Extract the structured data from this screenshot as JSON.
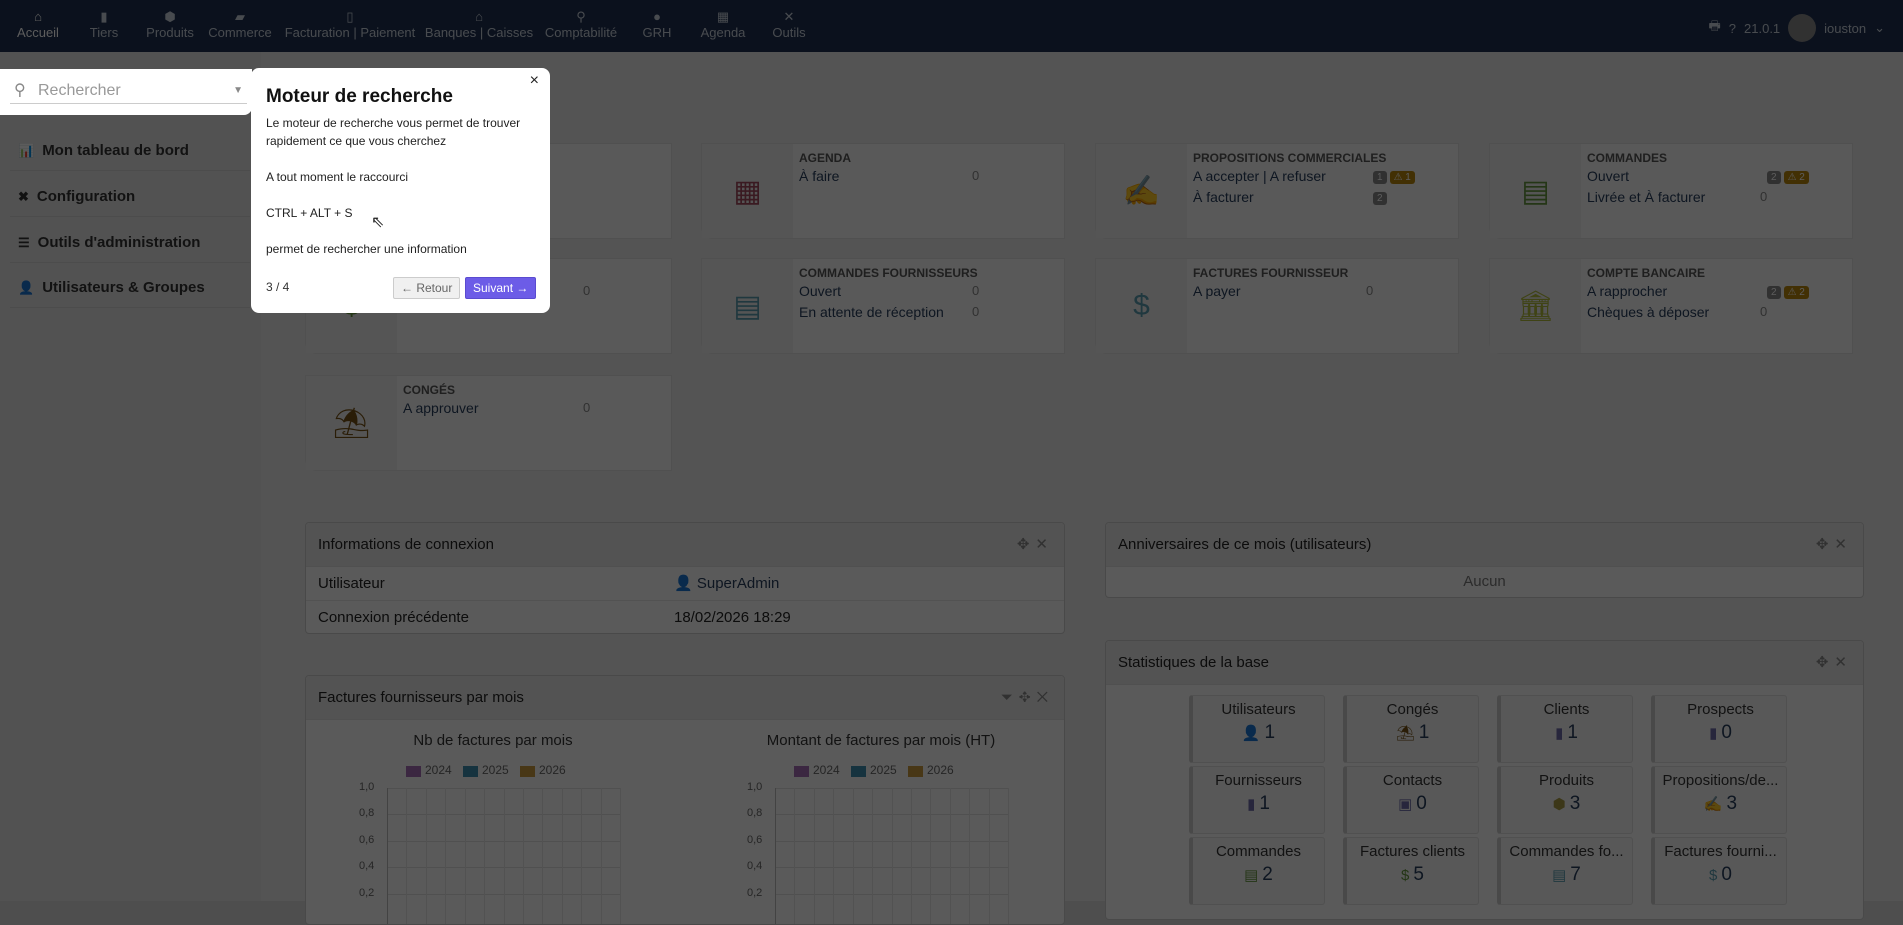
{
  "nav": {
    "items": [
      {
        "label": "Accueil",
        "icon": "home-icon",
        "glyph": "⌂"
      },
      {
        "label": "Tiers",
        "icon": "building-icon",
        "glyph": "▮"
      },
      {
        "label": "Produits",
        "icon": "cube-icon",
        "glyph": "⬢"
      },
      {
        "label": "Commerce",
        "icon": "briefcase-icon",
        "glyph": "▰"
      },
      {
        "label": "Facturation | Paiement",
        "icon": "invoice-icon",
        "glyph": "▯"
      },
      {
        "label": "Banques | Caisses",
        "icon": "bank-icon",
        "glyph": "⌂"
      },
      {
        "label": "Comptabilité",
        "icon": "search-dollar-icon",
        "glyph": "⚲"
      },
      {
        "label": "GRH",
        "icon": "user-tie-icon",
        "glyph": "●"
      },
      {
        "label": "Agenda",
        "icon": "calendar-icon",
        "glyph": "▦"
      },
      {
        "label": "Outils",
        "icon": "tools-icon",
        "glyph": "✕"
      }
    ],
    "version": "21.0.1",
    "user": "iouston"
  },
  "search": {
    "placeholder": "Rechercher"
  },
  "sidebar": {
    "items": [
      {
        "label": "Mon tableau de bord",
        "icon": "chart-icon",
        "glyph": "📊"
      },
      {
        "label": "Configuration",
        "icon": "tools-icon",
        "glyph": "✖"
      },
      {
        "label": "Outils d'administration",
        "icon": "server-icon",
        "glyph": "☰"
      },
      {
        "label": "Utilisateurs & Groupes",
        "icon": "user-icon",
        "glyph": "👤"
      }
    ]
  },
  "boxes": [
    {
      "title": "",
      "lines": [],
      "icon": "hidden-icon",
      "glyph": "",
      "color": "#3d6b2e"
    },
    {
      "title": "Agenda",
      "icon": "calendar-icon",
      "glyph": "▦",
      "color": "#a1485d",
      "lines": [
        {
          "label": "À faire",
          "value": "0"
        }
      ]
    },
    {
      "title": "Propositions commerciales",
      "icon": "proposal-signature-icon",
      "glyph": "✍",
      "color": "#65953d",
      "lines": [
        {
          "label": "A accepter | A refuser",
          "badge": "1",
          "warn": "⚠ 1"
        },
        {
          "label": "À facturer",
          "badge": "2"
        }
      ]
    },
    {
      "title": "Commandes",
      "icon": "order-document-icon",
      "glyph": "▤",
      "color": "#65953d",
      "lines": [
        {
          "label": "Ouvert",
          "badge": "2",
          "warn": "⚠ 2"
        },
        {
          "label": "Livrée et À facturer",
          "value": "0"
        }
      ]
    },
    {
      "title": "",
      "icon": "invoice-icon",
      "glyph": "$",
      "color": "#65953d",
      "lines": [
        {
          "label": "",
          "value": "0"
        }
      ]
    },
    {
      "title": "Commandes fournisseurs",
      "icon": "supplier-order-icon",
      "glyph": "▤",
      "color": "#599caf",
      "lines": [
        {
          "label": "Ouvert",
          "value": "0"
        },
        {
          "label": "En attente de réception",
          "value": "0"
        }
      ]
    },
    {
      "title": "Factures fournisseur",
      "icon": "supplier-invoice-icon",
      "glyph": "$",
      "color": "#599caf",
      "lines": [
        {
          "label": "A payer",
          "value": "0"
        }
      ]
    },
    {
      "title": "Compte bancaire",
      "icon": "bank-icon",
      "glyph": "🏛",
      "color": "#b0bb39",
      "lines": [
        {
          "label": "A rapprocher",
          "badge": "2",
          "warn": "⚠ 2"
        },
        {
          "label": "Chèques à déposer",
          "value": "0"
        }
      ]
    },
    {
      "title": "Congés",
      "icon": "beach-umbrella-icon",
      "glyph": "⛱",
      "color": "#755114",
      "lines": [
        {
          "label": "A approuver",
          "value": "0"
        }
      ]
    }
  ],
  "login_info": {
    "title": "Informations de connexion",
    "rows": [
      {
        "label": "Utilisateur",
        "value": "SuperAdmin"
      },
      {
        "label": "Connexion précédente",
        "value": "18/02/2026 18:29"
      }
    ]
  },
  "birthdays": {
    "title": "Anniversaires de ce mois (utilisateurs)",
    "empty": "Aucun"
  },
  "stats": {
    "title": "Statistiques de la base",
    "tiles": [
      {
        "label": "Utilisateurs",
        "value": "1",
        "icon": "user-icon",
        "glyph": "👤",
        "color": "#755114"
      },
      {
        "label": "Congés",
        "value": "1",
        "icon": "beach-umbrella-icon",
        "glyph": "⛱",
        "color": "#755114"
      },
      {
        "label": "Clients",
        "value": "1",
        "icon": "building-icon",
        "glyph": "▮",
        "color": "#6c6aa8"
      },
      {
        "label": "Prospects",
        "value": "0",
        "icon": "building-icon",
        "glyph": "▮",
        "color": "#6c6aa8"
      },
      {
        "label": "Fournisseurs",
        "value": "1",
        "icon": "building-icon",
        "glyph": "▮",
        "color": "#6c6aa8"
      },
      {
        "label": "Contacts",
        "value": "0",
        "icon": "contact-card-icon",
        "glyph": "▣",
        "color": "#6c6aa8"
      },
      {
        "label": "Produits",
        "value": "3",
        "icon": "cube-icon",
        "glyph": "⬢",
        "color": "#a69944"
      },
      {
        "label": "Propositions/de...",
        "value": "3",
        "icon": "proposal-signature-icon",
        "glyph": "✍",
        "color": "#65953d"
      },
      {
        "label": "Commandes",
        "value": "2",
        "icon": "order-document-icon",
        "glyph": "▤",
        "color": "#65953d"
      },
      {
        "label": "Factures clients",
        "value": "5",
        "icon": "invoice-icon",
        "glyph": "$",
        "color": "#65953d"
      },
      {
        "label": "Commandes fo...",
        "value": "7",
        "icon": "supplier-order-icon",
        "glyph": "▤",
        "color": "#599caf"
      },
      {
        "label": "Factures fourni...",
        "value": "0",
        "icon": "supplier-invoice-icon",
        "glyph": "$",
        "color": "#599caf"
      }
    ]
  },
  "invoices_panel": {
    "title": "Factures fournisseurs par mois"
  },
  "chart_data": [
    {
      "type": "bar",
      "title": "Nb de factures par mois",
      "legend": [
        "2024",
        "2025",
        "2026"
      ],
      "legend_colors": [
        "#a46bb4",
        "#3d8fae",
        "#c89a3c"
      ],
      "series": [
        {
          "name": "2024",
          "values": []
        },
        {
          "name": "2025",
          "values": []
        },
        {
          "name": "2026",
          "values": []
        }
      ],
      "yticks": [
        "1,0",
        "0,8",
        "0,6",
        "0,4",
        "0,2"
      ],
      "ylim": [
        0,
        1
      ],
      "grid": true,
      "legend_position": "top"
    },
    {
      "type": "bar",
      "title": "Montant de factures par mois (HT)",
      "legend": [
        "2024",
        "2025",
        "2026"
      ],
      "legend_colors": [
        "#a46bb4",
        "#3d8fae",
        "#c89a3c"
      ],
      "series": [
        {
          "name": "2024",
          "values": []
        },
        {
          "name": "2025",
          "values": []
        },
        {
          "name": "2026",
          "values": []
        }
      ],
      "yticks": [
        "1,0",
        "0,8",
        "0,6",
        "0,4",
        "0,2"
      ],
      "ylim": [
        0,
        1
      ],
      "grid": true,
      "legend_position": "top"
    }
  ],
  "tour": {
    "title": "Moteur de recherche",
    "p1": "Le moteur de recherche vous permet de trouver rapidement ce que vous cherchez",
    "p2": "A tout moment le raccourci",
    "p3": "CTRL + ALT + S",
    "p4": "permet de rechercher une information",
    "step": "3 / 4",
    "back": "← Retour",
    "next": "Suivant →",
    "close": "×",
    "accent": "#6c5ce7"
  }
}
